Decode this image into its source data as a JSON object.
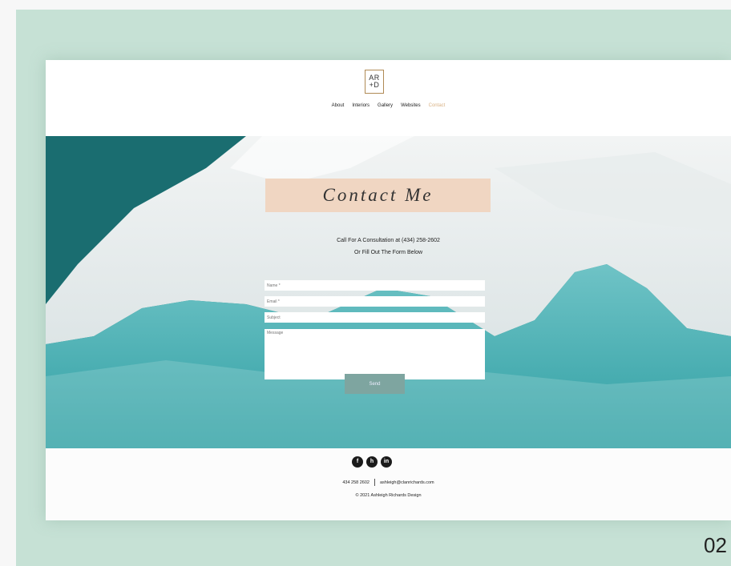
{
  "brand": {
    "logo_line1": "AR",
    "logo_line2": "+D"
  },
  "nav": {
    "items": [
      {
        "label": "About"
      },
      {
        "label": "Interiors"
      },
      {
        "label": "Gallery"
      },
      {
        "label": "Websites"
      },
      {
        "label": "Contact"
      }
    ],
    "active_color": "#d9b183"
  },
  "hero": {
    "title": "Contact Me",
    "sub_line1": "Call For A Consultation at (434) 258-2602",
    "sub_line2": "Or Fill Out The Form Below"
  },
  "form": {
    "name_placeholder": "Name *",
    "email_placeholder": "Email *",
    "subject_placeholder": "Subject",
    "message_placeholder": "Message",
    "send_label": "Send"
  },
  "footer": {
    "social": [
      {
        "icon": "facebook-icon",
        "glyph": "f"
      },
      {
        "icon": "houzz-icon",
        "glyph": "h"
      },
      {
        "icon": "linkedin-icon",
        "glyph": "in"
      }
    ],
    "phone": "434 258 2602",
    "email": "ashleigh@clanrichards.com",
    "copyright": "© 2021 Ashleigh Richards Design"
  },
  "overlay": {
    "corner_number": "02"
  },
  "colors": {
    "mint": "#c6e1d5",
    "title_box": "#f0d6c2",
    "send": "#7ea5a0",
    "teal": "#2a8a86"
  }
}
